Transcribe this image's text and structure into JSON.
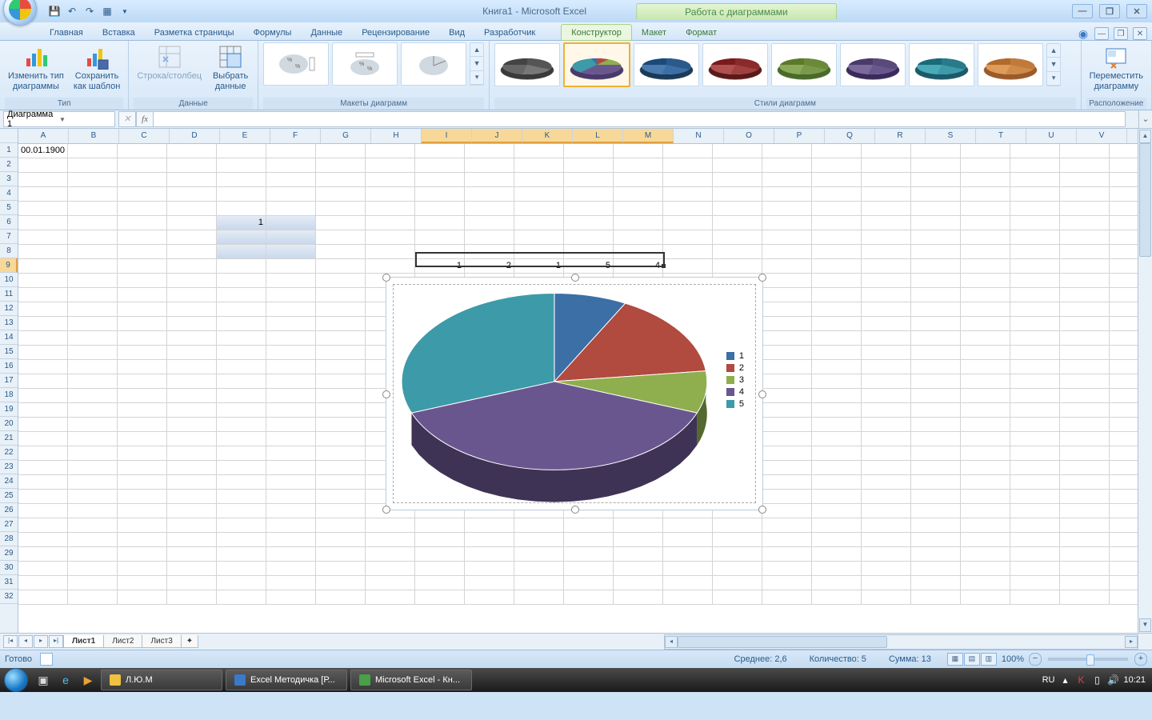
{
  "title_app": "Книга1 - Microsoft Excel",
  "title_tools": "Работа с диаграммами",
  "tabs": {
    "main": [
      "Главная",
      "Вставка",
      "Разметка страницы",
      "Формулы",
      "Данные",
      "Рецензирование",
      "Вид",
      "Разработчик"
    ],
    "context": [
      "Конструктор",
      "Макет",
      "Формат"
    ],
    "active": "Конструктор"
  },
  "ribbon": {
    "type_group": "Тип",
    "change_type": "Изменить тип\nдиаграммы",
    "save_template": "Сохранить\nкак шаблон",
    "data_group": "Данные",
    "switch_rc": "Строка/столбец",
    "select_data": "Выбрать\nданные",
    "layouts_group": "Макеты диаграмм",
    "styles_group": "Стили диаграмм",
    "location_group": "Расположение",
    "move_chart": "Переместить\nдиаграмму"
  },
  "name_box": "Диаграмма 1",
  "columns": [
    "A",
    "B",
    "C",
    "D",
    "E",
    "F",
    "G",
    "H",
    "I",
    "J",
    "K",
    "L",
    "M",
    "N",
    "O",
    "P",
    "Q",
    "R",
    "S",
    "T",
    "U",
    "V"
  ],
  "row_count": 32,
  "cellA1": "00.01.1900",
  "cellE6": "1",
  "sel_row_vals": [
    "1",
    "2",
    "1",
    "5",
    "4"
  ],
  "chart_data": {
    "type": "pie",
    "categories": [
      "1",
      "2",
      "3",
      "4",
      "5"
    ],
    "values": [
      1,
      2,
      1,
      5,
      4
    ],
    "colors": [
      "#3b6fa6",
      "#b14a3f",
      "#8fae4e",
      "#6a568f",
      "#3d9aa8"
    ]
  },
  "sheets": [
    "Лист1",
    "Лист2",
    "Лист3"
  ],
  "active_sheet": "Лист1",
  "status": {
    "ready": "Готово",
    "avg_label": "Среднее: 2,6",
    "count_label": "Количество: 5",
    "sum_label": "Сумма: 13",
    "zoom": "100%"
  },
  "taskbar": {
    "items": [
      "Л.Ю.М",
      "Excel Методичка [Р...",
      "Microsoft Excel - Кн..."
    ],
    "lang": "RU",
    "clock": "10:21"
  }
}
